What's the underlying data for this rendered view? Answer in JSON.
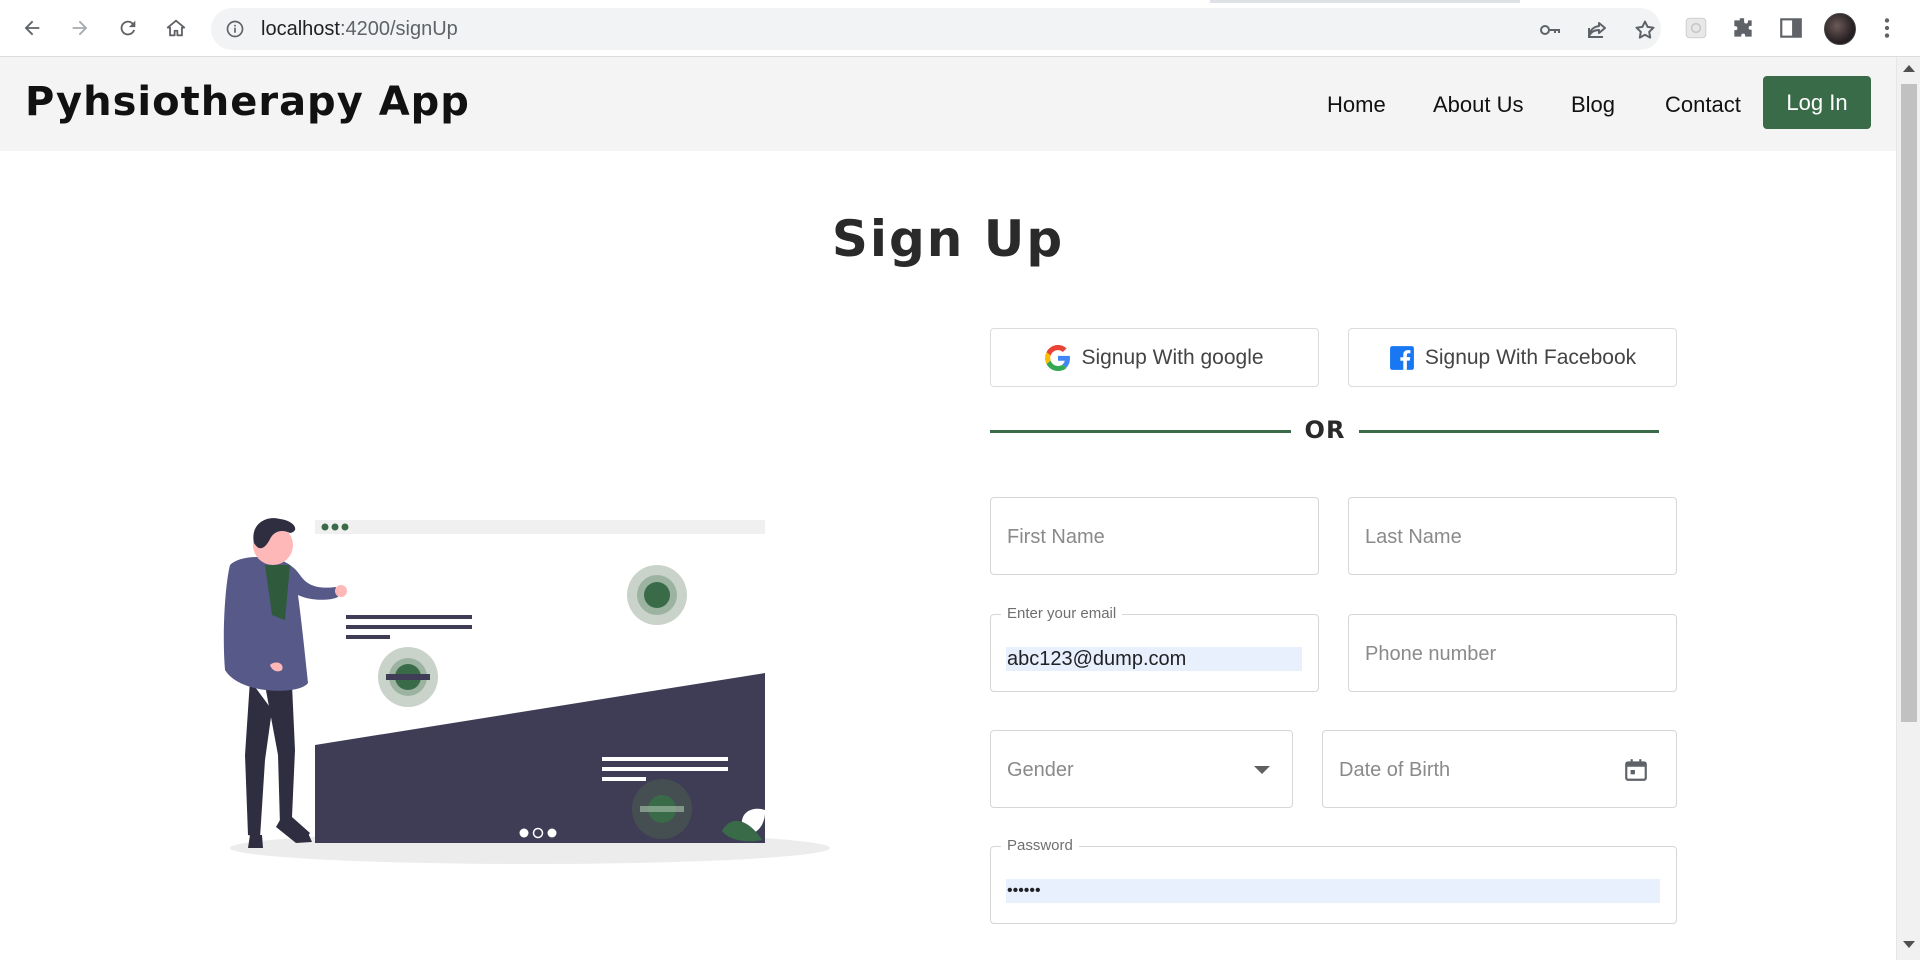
{
  "browser": {
    "url_host": "localhost",
    "url_rest": ":4200/signUp"
  },
  "header": {
    "brand": "Pyhsiotherapy App",
    "nav": [
      {
        "label": "Home"
      },
      {
        "label": "About Us"
      },
      {
        "label": "Blog"
      },
      {
        "label": "Contact"
      }
    ],
    "login_label": "Log In"
  },
  "main": {
    "title": "Sign Up",
    "google_label": "Signup With google",
    "facebook_label": "Signup With Facebook",
    "or_label": "OR",
    "first_name_placeholder": "First Name",
    "last_name_placeholder": "Last Name",
    "email_label": "Enter your email",
    "email_value": "abc123@dump.com",
    "phone_placeholder": "Phone number",
    "gender_placeholder": "Gender",
    "dob_placeholder": "Date of Birth",
    "password_label": "Password",
    "password_value": "••••••"
  },
  "colors": {
    "accent": "#3a6b49",
    "header_bg": "#f4f4f4",
    "autofill_bg": "#e8f0fe"
  },
  "icons": {
    "back": "arrow-left-icon",
    "forward": "arrow-right-icon",
    "reload": "reload-icon",
    "home": "home-icon",
    "info": "info-icon",
    "key": "key-icon",
    "share": "share-icon",
    "bookmark": "star-icon",
    "extension": "puzzle-icon",
    "sidepanel": "side-panel-icon",
    "menu": "kebab-menu-icon",
    "google": "google-logo-icon",
    "facebook": "facebook-logo-icon",
    "dropdown": "chevron-down-icon",
    "calendar": "calendar-icon"
  }
}
